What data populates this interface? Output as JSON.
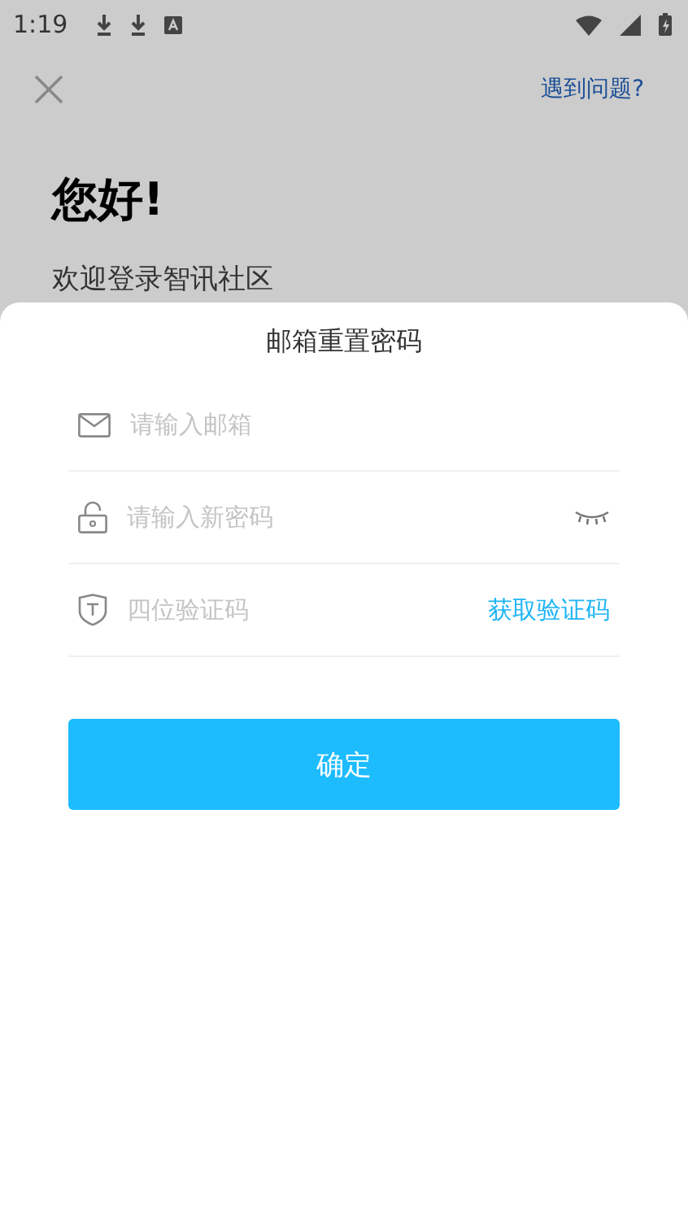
{
  "status_bar": {
    "time": "1:19"
  },
  "header": {
    "help_link": "遇到问题?"
  },
  "greeting": {
    "title": "您好!",
    "subtitle": "欢迎登录智讯社区"
  },
  "sheet": {
    "title": "邮箱重置密码",
    "fields": [
      {
        "kind": "email",
        "placeholder": "请输入邮箱"
      },
      {
        "kind": "password",
        "placeholder": "请输入新密码"
      },
      {
        "kind": "code",
        "placeholder": "四位验证码",
        "action": "获取验证码"
      }
    ],
    "submit": "确定"
  }
}
